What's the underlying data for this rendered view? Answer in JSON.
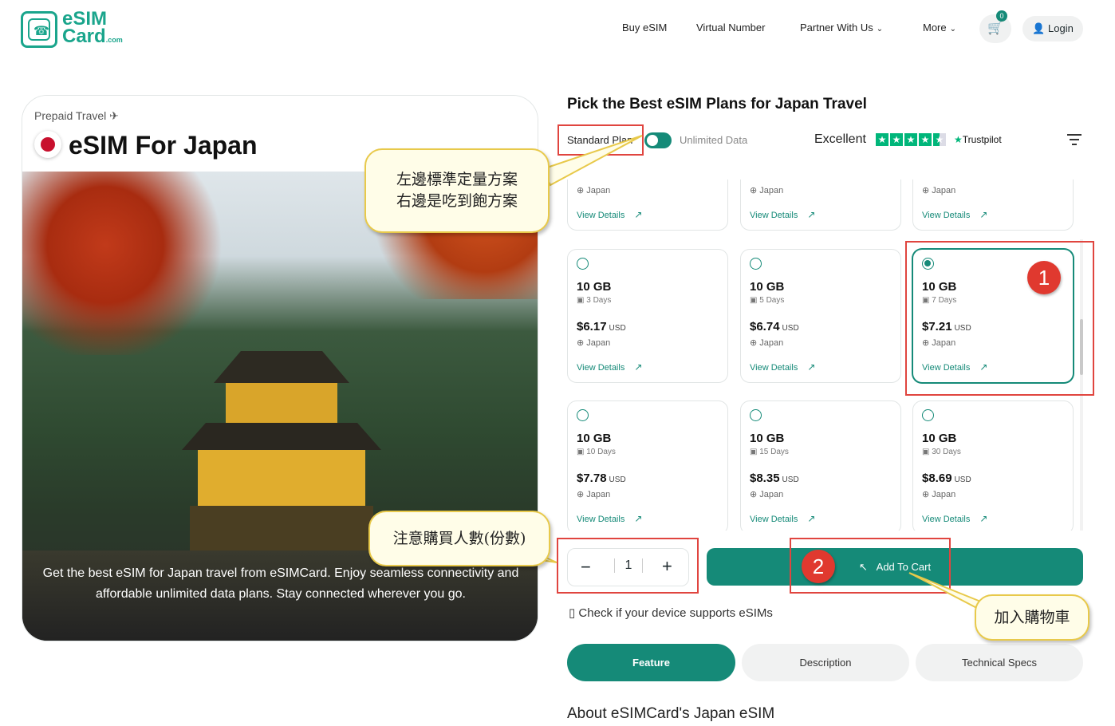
{
  "header": {
    "logo_line1": "eSIM",
    "logo_line2": "Card",
    "logo_suffix": ".com",
    "nav": [
      "Buy eSIM",
      "Virtual Number",
      "Partner With Us",
      "More"
    ],
    "cart_count": "0",
    "login_label": "Login"
  },
  "product": {
    "kicker": "Prepaid Travel",
    "title": "eSIM For Japan",
    "caption": "Get the best eSIM for Japan travel from eSIMCard. Enjoy seamless connectivity and affordable unlimited data plans. Stay connected wherever you go."
  },
  "plans_panel": {
    "title": "Pick the Best eSIM Plans for Japan Travel",
    "standard_label": "Standard Plan",
    "unlimited_label": "Unlimited Data",
    "rating_label": "Excellent",
    "trustpilot": "Trustpilot",
    "partial_row": [
      {
        "country": "Japan",
        "details": "View Details"
      },
      {
        "country": "Japan",
        "details": "View Details"
      },
      {
        "country": "Japan",
        "details": "View Details"
      }
    ],
    "plans": [
      {
        "gb": "10 GB",
        "days": "3 Days",
        "price": "$6.17",
        "currency": "USD",
        "country": "Japan",
        "details": "View Details",
        "selected": false
      },
      {
        "gb": "10 GB",
        "days": "5 Days",
        "price": "$6.74",
        "currency": "USD",
        "country": "Japan",
        "details": "View Details",
        "selected": false
      },
      {
        "gb": "10 GB",
        "days": "7 Days",
        "price": "$7.21",
        "currency": "USD",
        "country": "Japan",
        "details": "View Details",
        "selected": true
      },
      {
        "gb": "10 GB",
        "days": "10 Days",
        "price": "$7.78",
        "currency": "USD",
        "country": "Japan",
        "details": "View Details",
        "selected": false
      },
      {
        "gb": "10 GB",
        "days": "15 Days",
        "price": "$8.35",
        "currency": "USD",
        "country": "Japan",
        "details": "View Details",
        "selected": false
      },
      {
        "gb": "10 GB",
        "days": "30 Days",
        "price": "$8.69",
        "currency": "USD",
        "country": "Japan",
        "details": "View Details",
        "selected": false
      }
    ],
    "quantity": "1",
    "add_to_cart": "Add To Cart",
    "check_device": "Check if your device supports eSIMs",
    "tabs": [
      "Feature",
      "Description",
      "Technical Specs"
    ],
    "about_title": "About eSIMCard's Japan eSIM"
  },
  "annotations": {
    "bubble_plan_line1": "左邊標準定量方案",
    "bubble_plan_line2": "右邊是吃到飽方案",
    "bubble_qty": "注意購買人數(份數)",
    "bubble_cart": "加入購物車",
    "marker1": "1",
    "marker2": "2"
  },
  "colors": {
    "brand": "#158a78",
    "annotation_red": "#e0453f",
    "bubble_bg": "#fffde8"
  }
}
